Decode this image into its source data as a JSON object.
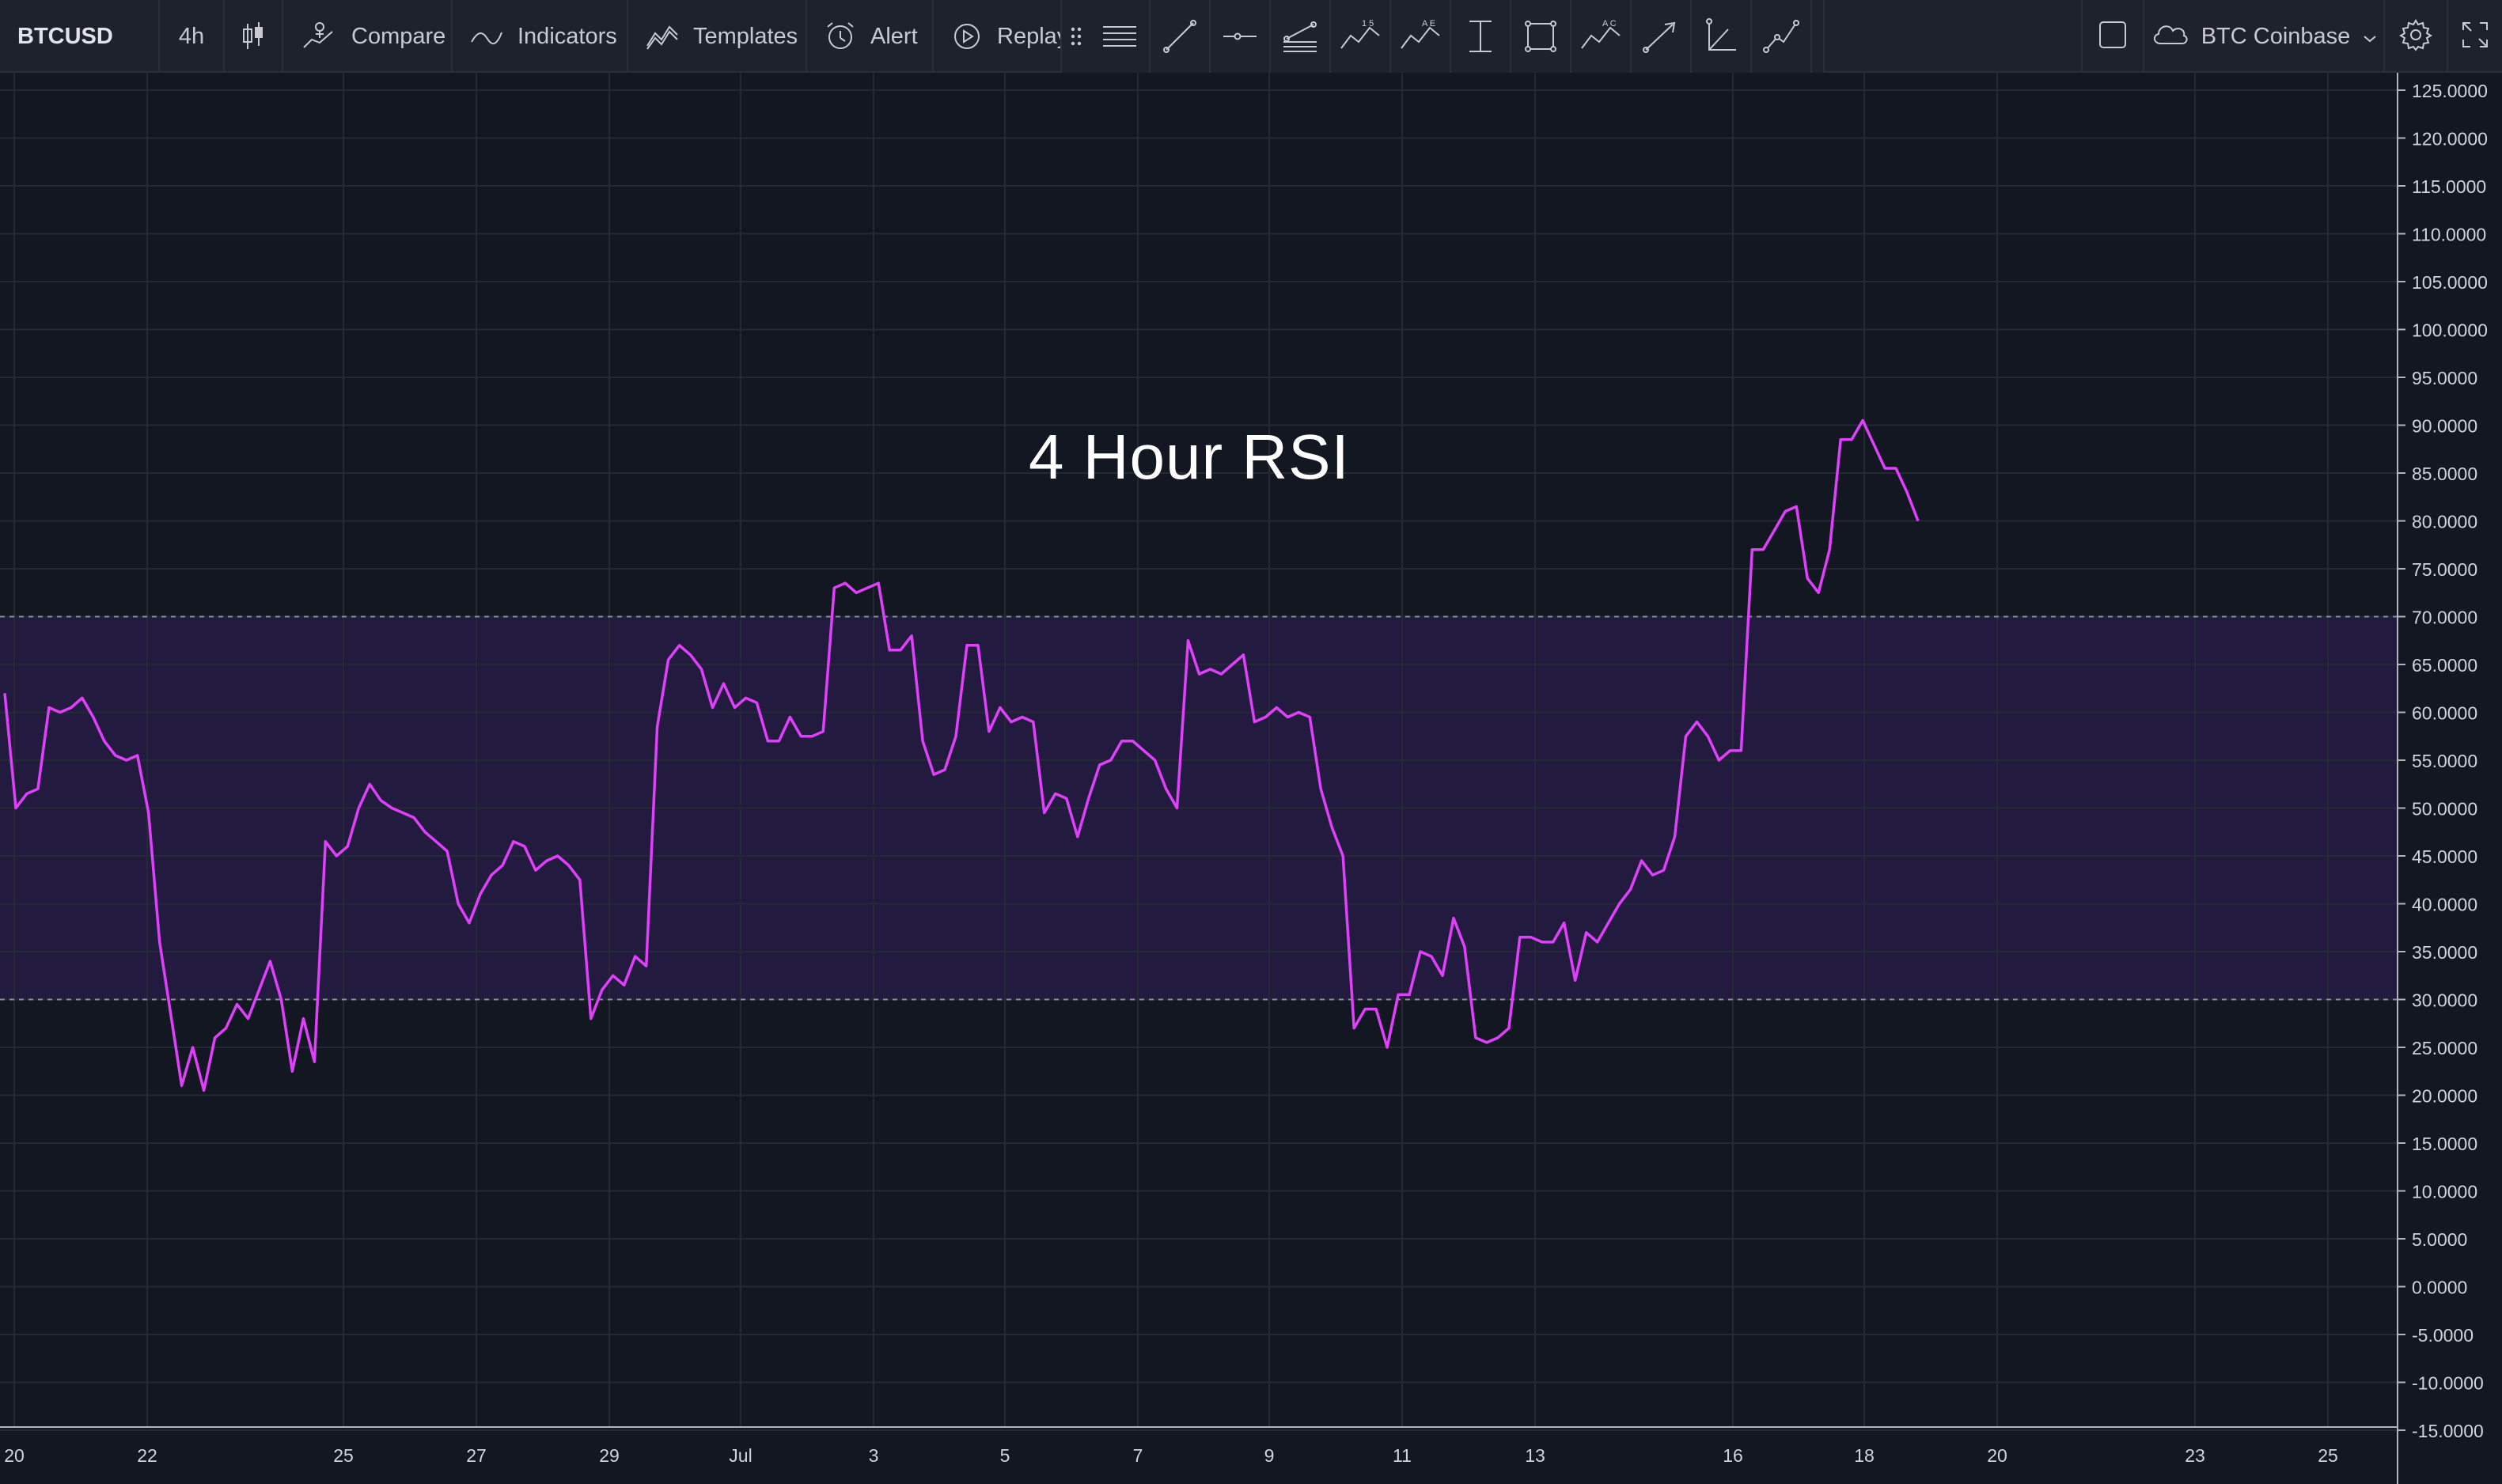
{
  "toolbar": {
    "symbol": "BTCUSD",
    "interval": "4h",
    "compare_label": "Compare",
    "indicators_label": "Indicators",
    "templates_label": "Templates",
    "alert_label": "Alert",
    "replay_label": "Replay",
    "exchange_label": "BTC Coinbase",
    "drawing_tools": [
      "horizontal-lines-icon",
      "trend-line-icon",
      "horizontal-ray-icon",
      "parallel-channel-icon",
      "pattern-15-icon",
      "pattern-ae-icon",
      "price-range-icon",
      "rectangle-icon",
      "pattern-ac-icon",
      "arrow-icon",
      "angle-icon",
      "path-icon"
    ]
  },
  "chart": {
    "title": "4 Hour RSI",
    "accent_line_color": "#e040fb",
    "band_color": "#2a1e4a"
  },
  "chart_data": {
    "type": "line",
    "title": "4 Hour RSI",
    "x_tick_labels": [
      "20",
      "22",
      "25",
      "27",
      "29",
      "Jul",
      "3",
      "5",
      "7",
      "9",
      "11",
      "13",
      "16",
      "18",
      "20",
      "23",
      "25"
    ],
    "y_tick_labels": [
      "125.0000",
      "120.0000",
      "115.0000",
      "110.0000",
      "105.0000",
      "100.0000",
      "95.0000",
      "90.0000",
      "85.0000",
      "80.0000",
      "75.0000",
      "70.0000",
      "65.0000",
      "60.0000",
      "55.0000",
      "50.0000",
      "45.0000",
      "40.0000",
      "35.0000",
      "30.0000",
      "25.0000",
      "20.0000",
      "15.0000",
      "10.0000",
      "5.0000",
      "0.0000",
      "-5.0000",
      "-10.0000",
      "-15.0000"
    ],
    "ylim": [
      -15,
      125
    ],
    "overbought": 70,
    "oversold": 30,
    "grid": true,
    "series": [
      {
        "values": [
          62,
          50,
          51.5,
          52,
          60.5,
          60,
          60.5,
          61.5,
          59.5,
          57,
          55.5,
          55,
          55.5,
          49.5,
          36,
          28.5,
          21,
          25,
          20.5,
          26,
          27,
          29.5,
          28,
          31,
          34,
          30,
          22.5,
          28,
          23.5,
          46.5,
          45,
          46,
          50,
          52.5,
          50.8,
          50,
          49.5,
          49,
          47.5,
          46.5,
          45.5,
          40,
          38,
          41,
          43,
          44,
          46.5,
          46,
          43.5,
          44.5,
          45,
          44,
          42.5,
          28,
          31,
          32.5,
          31.5,
          34.5,
          33.5,
          58.5,
          65.5,
          67,
          66,
          64.5,
          60.5,
          63,
          60.5,
          61.5,
          61,
          57,
          57,
          59.5,
          57.5,
          57.5,
          58,
          73,
          73.5,
          72.5,
          73,
          73.5,
          66.5,
          66.5,
          68,
          57,
          53.5,
          54,
          57.5,
          67,
          67,
          58,
          60.5,
          59,
          59.5,
          59,
          49.5,
          51.5,
          51,
          47,
          51,
          54.5,
          55,
          57,
          57,
          56,
          55,
          52,
          50,
          67.5,
          64,
          64.5,
          64,
          65,
          66,
          59,
          59.5,
          60.5,
          59.5,
          60,
          59.5,
          52,
          48,
          45,
          27,
          29,
          29,
          25,
          30.5,
          30.5,
          35,
          34.5,
          32.5,
          38.5,
          35.5,
          26,
          25.5,
          26,
          27,
          36.5,
          36.5,
          36,
          36,
          38,
          32,
          37,
          36,
          38,
          40,
          41.5,
          44.5,
          43,
          43.5,
          47,
          57.5,
          59,
          57.5,
          55,
          56,
          56,
          77,
          77,
          79,
          81,
          81.5,
          74,
          72.5,
          77,
          88.5,
          88.5,
          90.5,
          88,
          85.5,
          85.5,
          83,
          80
        ]
      }
    ]
  }
}
